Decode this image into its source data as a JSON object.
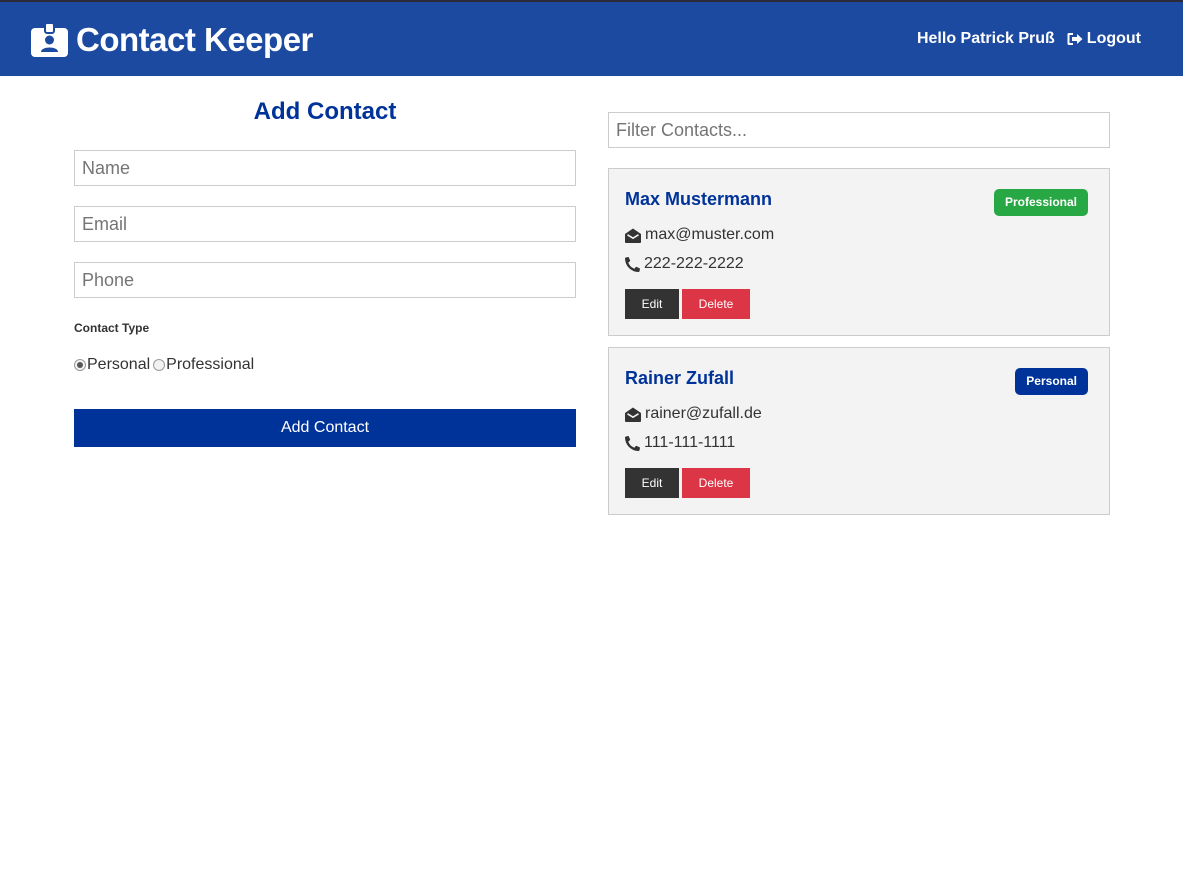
{
  "app": {
    "title": "Contact Keeper"
  },
  "nav": {
    "greeting": "Hello Patrick Pruß",
    "logout_label": "Logout"
  },
  "form": {
    "title": "Add Contact",
    "name_placeholder": "Name",
    "email_placeholder": "Email",
    "phone_placeholder": "Phone",
    "contact_type_label": "Contact Type",
    "options": [
      {
        "label": "Personal",
        "checked": true
      },
      {
        "label": "Professional",
        "checked": false
      }
    ],
    "submit_label": "Add Contact"
  },
  "filter": {
    "placeholder": "Filter Contacts..."
  },
  "contacts": [
    {
      "name": "Max Mustermann",
      "type": "Professional",
      "email": "max@muster.com",
      "phone": "222-222-2222",
      "edit_label": "Edit",
      "delete_label": "Delete"
    },
    {
      "name": "Rainer Zufall",
      "type": "Personal",
      "email": "rainer@zufall.de",
      "phone": "111-111-1111",
      "edit_label": "Edit",
      "delete_label": "Delete"
    }
  ],
  "colors": {
    "navbar": "#1c4aa1",
    "primary": "#003399",
    "success": "#28a745",
    "danger": "#dc3545",
    "dark": "#333333",
    "card_bg": "#f3f3f3"
  },
  "icons": {
    "brand": "id-badge-icon",
    "logout": "sign-out-icon",
    "email": "envelope-open-icon",
    "phone": "phone-icon"
  }
}
